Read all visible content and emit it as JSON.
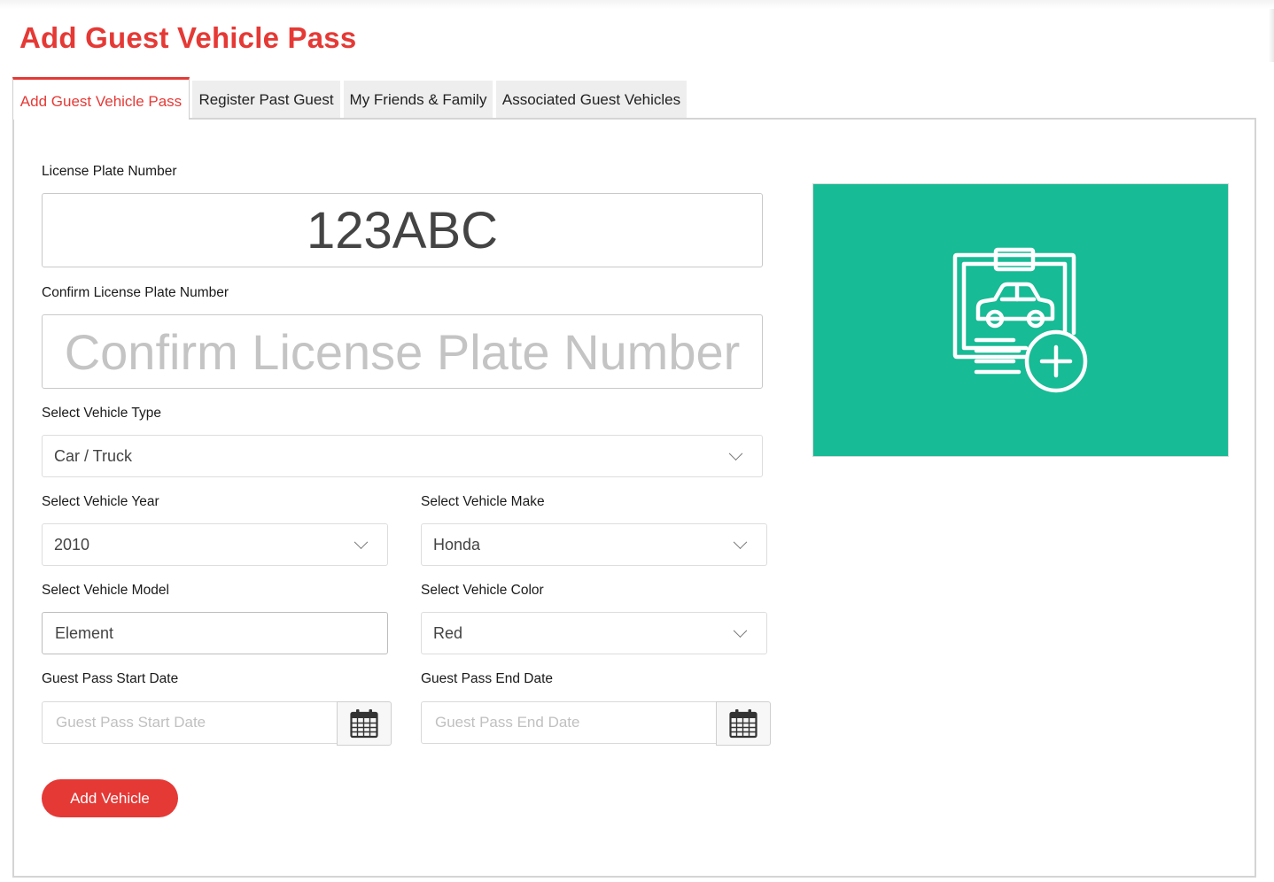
{
  "page": {
    "title": "Add Guest Vehicle Pass"
  },
  "tabs": [
    {
      "label": "Add Guest Vehicle Pass",
      "active": true
    },
    {
      "label": "Register Past Guest",
      "active": false
    },
    {
      "label": "My Friends & Family",
      "active": false
    },
    {
      "label": "Associated Guest Vehicles",
      "active": false
    }
  ],
  "form": {
    "plate": {
      "label": "License Plate Number",
      "value": "123ABC"
    },
    "confirm_plate": {
      "label": "Confirm License Plate Number",
      "value": "",
      "placeholder": "Confirm License Plate Number"
    },
    "vehicle_type": {
      "label": "Select Vehicle Type",
      "value": "Car / Truck"
    },
    "year": {
      "label": "Select Vehicle Year",
      "value": "2010"
    },
    "make": {
      "label": "Select Vehicle Make",
      "value": "Honda"
    },
    "model": {
      "label": "Select Vehicle Model",
      "value": "Element"
    },
    "color": {
      "label": "Select Vehicle Color",
      "value": "Red"
    },
    "start_date": {
      "label": "Guest Pass Start Date",
      "value": "",
      "placeholder": "Guest Pass Start Date"
    },
    "end_date": {
      "label": "Guest Pass End Date",
      "value": "",
      "placeholder": "Guest Pass End Date"
    },
    "submit_label": "Add Vehicle"
  },
  "illustration": {
    "icon": "clipboard-car-add-icon",
    "background": "#17bb95"
  },
  "colors": {
    "accent": "#e53935",
    "illustration_bg": "#17bb95"
  }
}
